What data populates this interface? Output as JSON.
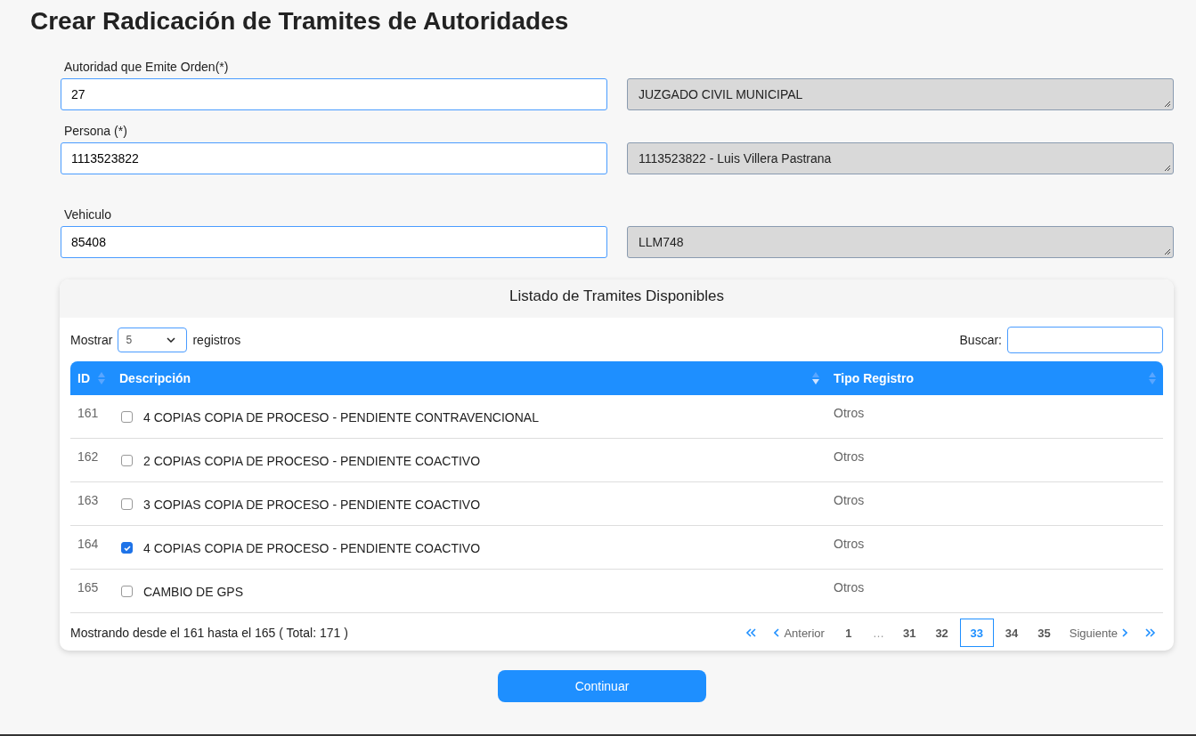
{
  "title": "Crear Radicación de Tramites de Autoridades",
  "fields": [
    {
      "label": "Autoridad que Emite Orden(*)",
      "value": "27",
      "description": "JUZGADO CIVIL MUNICIPAL"
    },
    {
      "label": "Persona (*)",
      "value": "1113523822",
      "description": "1113523822 - Luis Villera Pastrana"
    },
    {
      "label": "Vehiculo",
      "value": "85408",
      "description": "LLM748"
    }
  ],
  "table_card": {
    "title": "Listado de Tramites Disponibles",
    "length_label_before": "Mostrar",
    "length_value": "5",
    "length_label_after": "registros",
    "search_label": "Buscar:",
    "columns": [
      {
        "label": "ID",
        "sorted": false
      },
      {
        "label": "Descripción",
        "sorted": true
      },
      {
        "label": "Tipo Registro",
        "sorted": false
      }
    ],
    "rows": [
      {
        "id": "161",
        "checked": false,
        "description": "4 COPIAS COPIA DE PROCESO - PENDIENTE CONTRAVENCIONAL",
        "type": "Otros"
      },
      {
        "id": "162",
        "checked": false,
        "description": "2 COPIAS COPIA DE PROCESO - PENDIENTE COACTIVO",
        "type": "Otros"
      },
      {
        "id": "163",
        "checked": false,
        "description": "3 COPIAS COPIA DE PROCESO - PENDIENTE COACTIVO",
        "type": "Otros"
      },
      {
        "id": "164",
        "checked": true,
        "description": "4 COPIAS COPIA DE PROCESO - PENDIENTE COACTIVO",
        "type": "Otros"
      },
      {
        "id": "165",
        "checked": false,
        "description": "CAMBIO DE GPS",
        "type": "Otros"
      }
    ],
    "info": "Mostrando desde el 161 hasta el 165 ( Total: 171 )",
    "pagination": [
      {
        "kind": "first"
      },
      {
        "kind": "prev",
        "label": "Anterior"
      },
      {
        "kind": "page",
        "label": "1",
        "selected": false
      },
      {
        "kind": "ellipsis",
        "label": "…"
      },
      {
        "kind": "page",
        "label": "31",
        "selected": false
      },
      {
        "kind": "page",
        "label": "32",
        "selected": false
      },
      {
        "kind": "page",
        "label": "33",
        "selected": true
      },
      {
        "kind": "page",
        "label": "34",
        "selected": false
      },
      {
        "kind": "page",
        "label": "35",
        "selected": false
      },
      {
        "kind": "next",
        "label": "Siguiente"
      },
      {
        "kind": "last"
      }
    ]
  },
  "continue_button": "Continuar"
}
